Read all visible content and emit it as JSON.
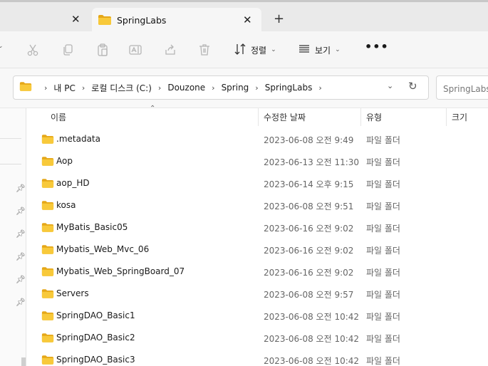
{
  "tabs": [
    {
      "label": "",
      "active": false
    },
    {
      "label": "SpringLabs",
      "active": true
    }
  ],
  "new_tab_glyph": "+",
  "toolbar": {
    "sort_label": "정렬",
    "view_label": "보기",
    "more_glyph": "•••",
    "icons": [
      "cut-icon",
      "copy-icon",
      "paste-icon",
      "rename-icon",
      "share-icon",
      "delete-icon",
      "sort-icon",
      "view-icon"
    ]
  },
  "address": {
    "crumbs": [
      "내 PC",
      "로컬 디스크 (C:)",
      "Douzone",
      "Spring",
      "SpringLabs"
    ]
  },
  "search": {
    "placeholder": "SpringLabs 검색"
  },
  "columns": {
    "name": "이름",
    "date": "수정한 날짜",
    "type": "유형",
    "size": "크기"
  },
  "files": [
    {
      "name": ".metadata",
      "date": "2023-06-08 오전 9:49",
      "type": "파일 폴더"
    },
    {
      "name": "Aop",
      "date": "2023-06-13 오전 11:30",
      "type": "파일 폴더"
    },
    {
      "name": "aop_HD",
      "date": "2023-06-14 오후 9:15",
      "type": "파일 폴더"
    },
    {
      "name": "kosa",
      "date": "2023-06-08 오전 9:51",
      "type": "파일 폴더"
    },
    {
      "name": "MyBatis_Basic05",
      "date": "2023-06-16 오전 9:02",
      "type": "파일 폴더"
    },
    {
      "name": "Mybatis_Web_Mvc_06",
      "date": "2023-06-16 오전 9:02",
      "type": "파일 폴더"
    },
    {
      "name": "Mybatis_Web_SpringBoard_07",
      "date": "2023-06-16 오전 9:02",
      "type": "파일 폴더"
    },
    {
      "name": "Servers",
      "date": "2023-06-08 오전 9:57",
      "type": "파일 폴더"
    },
    {
      "name": "SpringDAO_Basic1",
      "date": "2023-06-08 오전 10:42",
      "type": "파일 폴더"
    },
    {
      "name": "SpringDAO_Basic2",
      "date": "2023-06-08 오전 10:42",
      "type": "파일 폴더"
    },
    {
      "name": "SpringDAO_Basic3",
      "date": "2023-06-08 오전 10:42",
      "type": "파일 폴더"
    }
  ],
  "colors": {
    "folder": "#f8c93a",
    "folder_dark": "#e5a718",
    "accent": "#0067c0"
  }
}
